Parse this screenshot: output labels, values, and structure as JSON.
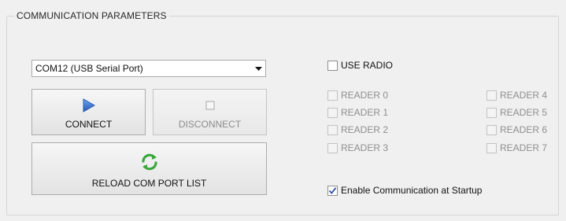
{
  "group": {
    "title": "COMMUNICATION PARAMETERS"
  },
  "port_select": {
    "value": "COM12 (USB Serial Port)",
    "icon": "chevron-down-icon"
  },
  "buttons": {
    "connect": {
      "label": "CONNECT",
      "icon": "play-icon",
      "enabled": true
    },
    "disconnect": {
      "label": "DISCONNECT",
      "icon": "stop-icon",
      "enabled": false
    },
    "reload": {
      "label": "RELOAD COM PORT LIST",
      "icon": "refresh-icon",
      "enabled": true
    }
  },
  "use_radio": {
    "label": "USE RADIO",
    "checked": false
  },
  "readers": [
    {
      "label": "READER 0",
      "checked": false,
      "enabled": false
    },
    {
      "label": "READER 1",
      "checked": false,
      "enabled": false
    },
    {
      "label": "READER 2",
      "checked": false,
      "enabled": false
    },
    {
      "label": "READER 3",
      "checked": false,
      "enabled": false
    },
    {
      "label": "READER 4",
      "checked": false,
      "enabled": false
    },
    {
      "label": "READER 5",
      "checked": false,
      "enabled": false
    },
    {
      "label": "READER 6",
      "checked": false,
      "enabled": false
    },
    {
      "label": "READER 7",
      "checked": false,
      "enabled": false
    }
  ],
  "startup": {
    "label": "Enable Communication at Startup",
    "checked": true
  },
  "colors": {
    "background": "#f0f0f0",
    "play_icon": "#2f6fd0",
    "refresh_icon": "#3aa63a",
    "checkmark": "#2b4fa8"
  }
}
